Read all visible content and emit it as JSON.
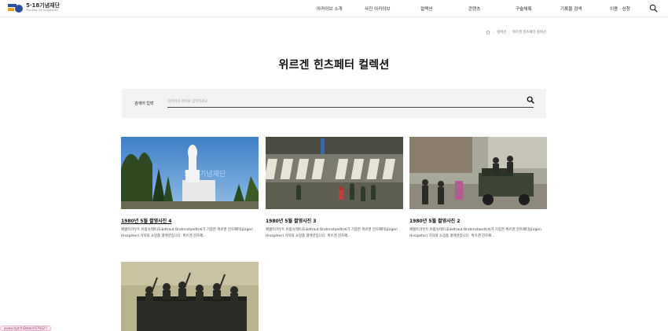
{
  "header": {
    "logo_kr": "5·18기념재단",
    "logo_en": "The May 18 Foundation",
    "nav": [
      "아카이브 소개",
      "사진 아카이브",
      "컬렉션",
      "콘텐츠",
      "구술채록",
      "기록물 검색",
      "이용 · 신청"
    ]
  },
  "breadcrumb": {
    "items": [
      "컬렉션",
      "위르겐 힌츠페터 컬렉션"
    ]
  },
  "page": {
    "title": "위르겐 힌츠페터 컬렉션"
  },
  "search": {
    "label": "검색어 입력",
    "placeholder": "검색어의 제목을 입력하세요."
  },
  "cards": [
    {
      "title": "1980년 5월 촬영사진 4",
      "desc": "에델트라우트 브람슈테트(Edeltraut Brahmstaedt)씨가 기증한 위르겐 힌츠페터(Jürgen Hinzpeter) 기자의 소장품 컬렉션입니다. 위르겐 힌츠페...",
      "img_watermark": "5·18기념재단"
    },
    {
      "title": "1980년 5월 촬영사진 3",
      "desc": "에델트라우트 브람슈테트(Edeltraut Brahmstaedt)씨가 기증한 위르겐 힌츠페터(Jürgen Hinzpeter) 기자의 소장품 컬렉션입니다. 위르겐 힌츠페..."
    },
    {
      "title": "1980년 5월 촬영사진 2",
      "desc": "에델트라우트 브람슈테트(Edeltraut Brahmstaedt)씨가 기증한 위르겐 힌츠페터(Jürgen Hinzpeter) 기자의 소장품 컬렉션입니다. 위르겐 힌츠페..."
    },
    {
      "title": "",
      "desc": ""
    }
  ],
  "status_chip": "javascript:fnDetail('67912')",
  "colors": {
    "brand_blue": "#2b4f9e",
    "brand_orange": "#e8a21b",
    "search_bg": "#f3f3f3"
  }
}
